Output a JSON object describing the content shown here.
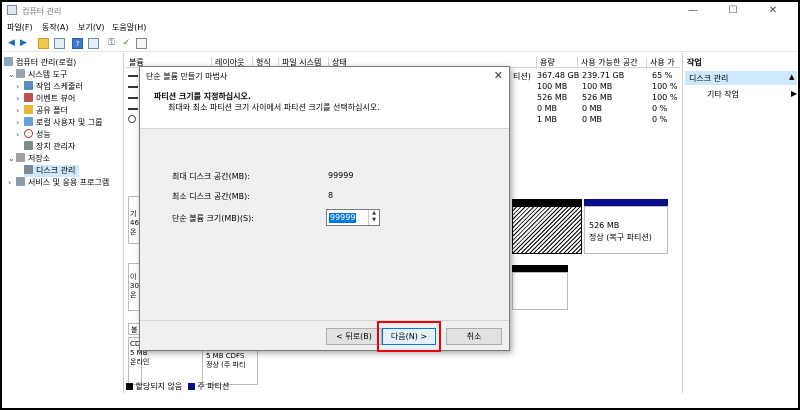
{
  "window": {
    "title": "컴퓨터 관리"
  },
  "menu": [
    "파일(F)",
    "동작(A)",
    "보기(V)",
    "도움말(H)"
  ],
  "tree": [
    {
      "label": "컴퓨터 관리(로컬)",
      "indent": 0,
      "expand": ""
    },
    {
      "label": "시스템 도구",
      "indent": 1,
      "expand": "⌄"
    },
    {
      "label": "작업 스케줄러",
      "indent": 2,
      "expand": "›"
    },
    {
      "label": "이벤트 뷰어",
      "indent": 2,
      "expand": "›"
    },
    {
      "label": "공유 폴더",
      "indent": 2,
      "expand": "›"
    },
    {
      "label": "로컬 사용자 및 그룹",
      "indent": 2,
      "expand": "›"
    },
    {
      "label": "성능",
      "indent": 2,
      "expand": "›"
    },
    {
      "label": "장치 관리자",
      "indent": 2,
      "expand": ""
    },
    {
      "label": "저장소",
      "indent": 1,
      "expand": "⌄"
    },
    {
      "label": "디스크 관리",
      "indent": 2,
      "expand": ""
    },
    {
      "label": "서비스 및 응용 프로그램",
      "indent": 1,
      "expand": "›"
    }
  ],
  "volumes": {
    "headers": [
      "볼륨",
      "레이아웃",
      "형식",
      "파일 시스템",
      "상태",
      "용량",
      "사용 가능한 공간",
      "사용 가"
    ],
    "rows": [
      {
        "status_tail": "티션)",
        "capacity": "367.48 GB",
        "free": "239.71 GB",
        "pct": "65 %"
      },
      {
        "status_tail": "",
        "capacity": "100 MB",
        "free": "100 MB",
        "pct": "100 %"
      },
      {
        "status_tail": "",
        "capacity": "526 MB",
        "free": "526 MB",
        "pct": "100 %"
      },
      {
        "status_tail": "",
        "capacity": "0 MB",
        "free": "0 MB",
        "pct": "0 %"
      },
      {
        "status_tail": "",
        "capacity": "1 MB",
        "free": "0 MB",
        "pct": "0 %"
      }
    ]
  },
  "graphical": {
    "disk0_part_size": "526 MB",
    "disk0_part_status": "정상 (복구 파티션)",
    "disk0_frag": "기\n46\n온",
    "disk1_frag": "이\n30\n온",
    "cd_label": "CD\n5 MB\n온라인",
    "cd_part": "5 MB CDFS\n정상 (주 파티",
    "disk_frag_label": "볼"
  },
  "legend": {
    "unallocated": "할당되지 않음",
    "primary": "주 파티션"
  },
  "actions": {
    "header": "작업",
    "section": "디스크 관리",
    "item": "기타 작업"
  },
  "dialog": {
    "title": "단순 볼륨 만들기 마법사",
    "heading": "파티션 크기를 지정하십시오.",
    "subheading": "최대와 최소 파티션 크기 사이에서 파티션 크기를 선택하십시오.",
    "max_label": "최대 디스크 공간(MB):",
    "max_value": "99999",
    "min_label": "최소 디스크 공간(MB):",
    "min_value": "8",
    "size_label": "단순 볼륨 크기(MB)(S):",
    "size_value": "99999",
    "back": "< 뒤로(B)",
    "next": "다음(N) >",
    "cancel": "취소"
  },
  "colors": {
    "highlight": "#e8000b",
    "selection": "#cde8ff",
    "primary_partition": "#0a0e8a"
  }
}
